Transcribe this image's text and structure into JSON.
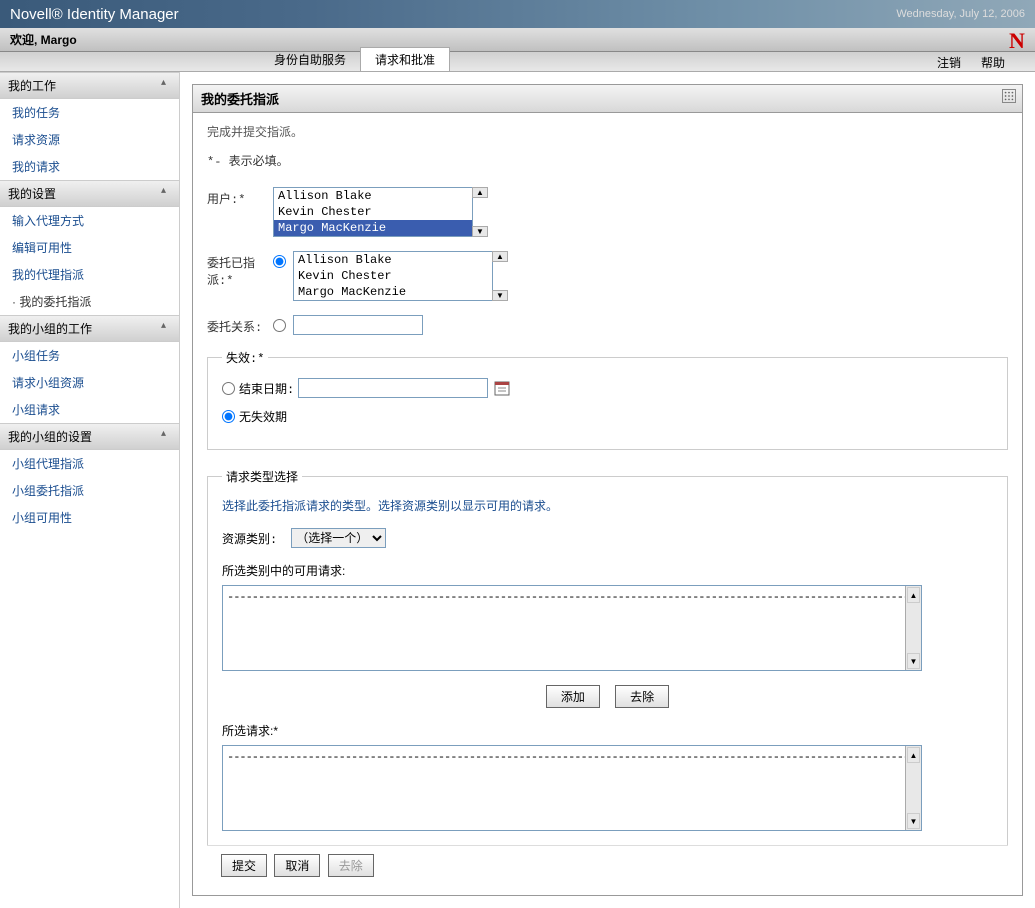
{
  "header": {
    "title": "Novell® Identity Manager",
    "date": "Wednesday, July 12, 2006",
    "logo": "N"
  },
  "welcome": "欢迎, Margo",
  "tabs": {
    "t1": "身份自助服务",
    "t2": "请求和批准",
    "logout": "注销",
    "help": "帮助"
  },
  "sidebar": {
    "g1": "我的工作",
    "g1_1": "我的任务",
    "g1_2": "请求资源",
    "g1_3": "我的请求",
    "g2": "我的设置",
    "g2_1": "输入代理方式",
    "g2_2": "编辑可用性",
    "g2_3": "我的代理指派",
    "g2_4": "我的委托指派",
    "g3": "我的小组的工作",
    "g3_1": "小组任务",
    "g3_2": "请求小组资源",
    "g3_3": "小组请求",
    "g4": "我的小组的设置",
    "g4_1": "小组代理指派",
    "g4_2": "小组委托指派",
    "g4_3": "小组可用性",
    "collapse": "☆"
  },
  "panel": {
    "title": "我的委托指派",
    "instruction": "完成并提交指派。",
    "required_note": "*- 表示必填。",
    "user_label": "用户:*",
    "users": [
      "Allison Blake",
      "Kevin Chester",
      "Margo MacKenzie"
    ],
    "delegated_label": "委托已指派:*",
    "delegates": [
      "Allison Blake",
      "Kevin Chester",
      "Margo MacKenzie"
    ],
    "relation_label": "委托关系:",
    "expiry": {
      "legend": "失效:*",
      "end_date": "结束日期:",
      "no_expiry": "无失效期"
    },
    "reqtype": {
      "legend": "请求类型选择",
      "note": "选择此委托指派请求的类型。选择资源类别以显示可用的请求。",
      "cat_label": "资源类别:",
      "cat_value": "（选择一个）",
      "avail_label": "所选类别中的可用请求:",
      "dashes": "--------------------------------------------------------------------------------------------------------------------------------------",
      "add": "添加",
      "remove": "去除",
      "selected_label": "所选请求:*"
    },
    "submit": "提交",
    "cancel": "取消",
    "delete": "去除"
  }
}
